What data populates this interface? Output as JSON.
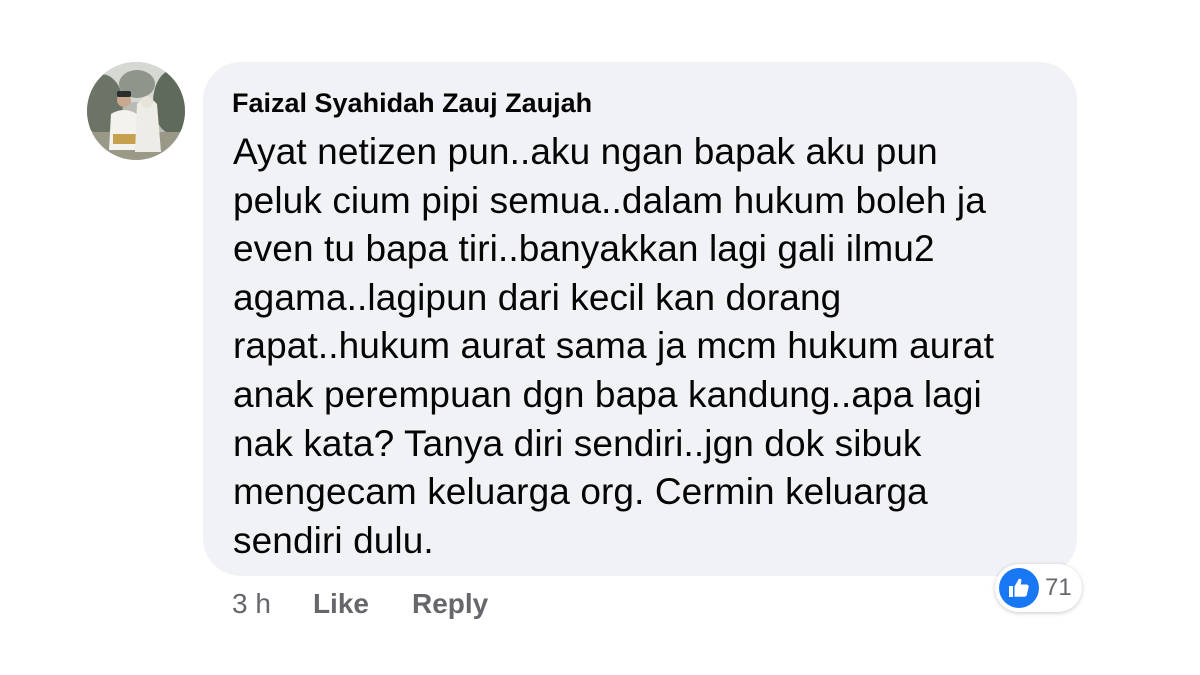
{
  "comment": {
    "author": "Faizal Syahidah Zauj Zaujah",
    "lines": [
      "Ayat netizen pun..aku ngan bapak aku pun",
      "peluk cium pipi semua..dalam hukum boleh ja",
      "even tu bapa tiri..banyakkan lagi gali ilmu2",
      "agama..lagipun dari kecil kan dorang",
      "rapat..hukum aurat sama ja mcm hukum aurat",
      "anak perempuan dgn bapa kandung..apa lagi",
      "nak kata? Tanya diri sendiri..jgn dok sibuk",
      "mengecam keluarga org. Cermin keluarga",
      "sendiri dulu."
    ],
    "timestamp": "3 h",
    "like_label": "Like",
    "reply_label": "Reply",
    "reaction_count": "71",
    "reaction_icon": "thumbs-up-icon"
  },
  "colors": {
    "bubble_background": "#f0f2f5",
    "text_primary": "#050505",
    "text_secondary": "#65676b",
    "like_blue": "#1877f2"
  }
}
